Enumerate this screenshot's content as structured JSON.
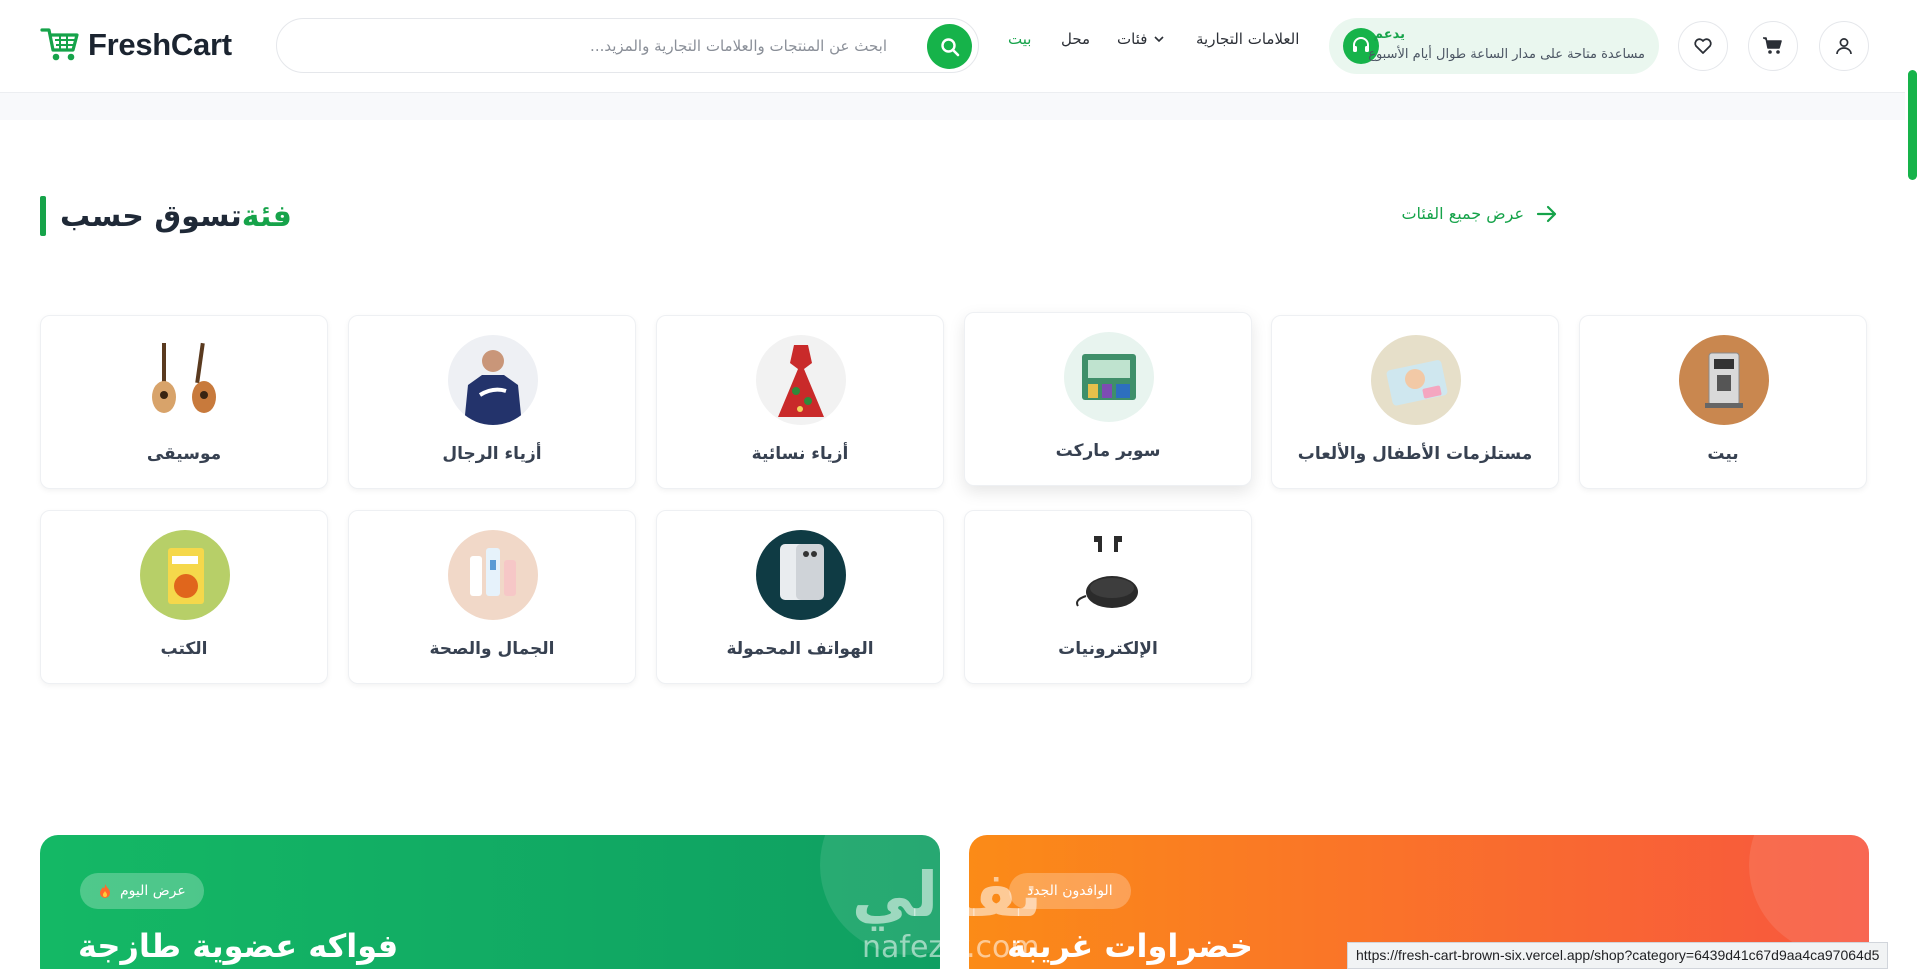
{
  "header": {
    "logo_text": "FreshCart",
    "search_placeholder": "ابحث عن المنتجات والعلامات التجارية والمزيد...",
    "nav": {
      "home": "بيت",
      "shop": "محل",
      "categories": "فئات",
      "brands": "العلامات التجارية"
    },
    "support": {
      "title": "يدعم",
      "subtitle": "مساعدة متاحة على مدار الساعة طوال أيام الأسبوع"
    },
    "brand_color": "#16b34a"
  },
  "section": {
    "title_main": "تسوق حسب ",
    "title_accent": "فئة",
    "view_all": "عرض جميع الفئات"
  },
  "categories": [
    {
      "label": "بيت",
      "icon": "coffee-machine-icon",
      "color": "#c9874f"
    },
    {
      "label": "مستلزمات الأطفال والألعاب",
      "icon": "baby-products-icon",
      "color": "#e6dfc9"
    },
    {
      "label": "سوبر ماركت",
      "icon": "grocery-icon",
      "color": "#3f8f6a"
    },
    {
      "label": "أزياء نسائية",
      "icon": "dress-icon",
      "color": "#c92a2a"
    },
    {
      "label": "أزياء الرجال",
      "icon": "hoodie-icon",
      "color": "#23336b"
    },
    {
      "label": "موسيقى",
      "icon": "guitar-icon",
      "color": "#c87a3c"
    },
    {
      "label": "الإلكترونيات",
      "icon": "earbuds-icon",
      "color": "#2b2b2b"
    },
    {
      "label": "الهواتف المحمولة",
      "icon": "smartphone-icon",
      "color": "#0f3b44"
    },
    {
      "label": "الجمال والصحة",
      "icon": "cosmetics-icon",
      "color": "#f1d8c8"
    },
    {
      "label": "الكتب",
      "icon": "book-icon",
      "color": "#b7cf68"
    }
  ],
  "promos": [
    {
      "badge": "عرض اليوم",
      "headline": "فواكه عضوية طازجة",
      "badge_icon": "fire-icon"
    },
    {
      "badge": "الوافدون الجدد",
      "headline": "خضراوات غريبة"
    }
  ],
  "watermark": {
    "arabic": "نفذلي",
    "latin": "nafezly.com"
  },
  "status_url": "https://fresh-cart-brown-six.vercel.app/shop?category=6439d41c67d9aa4ca97064d5"
}
